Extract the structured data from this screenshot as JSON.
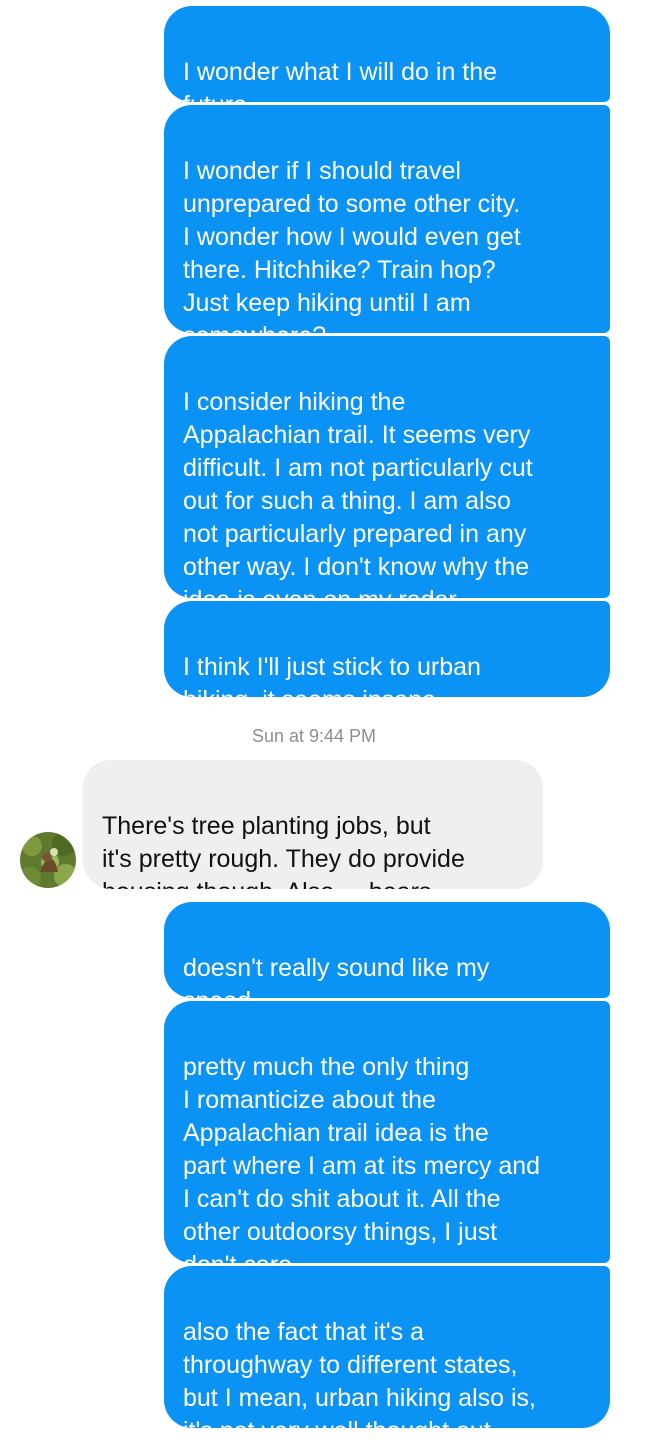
{
  "thread": {
    "messages_before": [
      {
        "sender": "me",
        "text": "I wonder what I will do in the\nfuture."
      },
      {
        "sender": "me",
        "text": "I wonder if I should travel\nunprepared to some other city.\nI wonder how I would even get\nthere. Hitchhike? Train hop?\nJust keep hiking until I am\nsomewhere?"
      },
      {
        "sender": "me",
        "text": "I consider hiking the\nAppalachian trail. It seems very\ndifficult. I am not particularly cut\nout for such a thing. I am also\nnot particularly prepared in any\nother way. I don't know why the\nidea is even on my radar."
      },
      {
        "sender": "me",
        "text": "I think I'll just stick to urban\nhiking, it seems insane"
      }
    ],
    "timestamp": "Sun at 9:44 PM",
    "incoming": {
      "sender": "other",
      "text": "There's tree planting jobs, but\nit's pretty rough. They do provide\nhousing though. Also ... bears."
    },
    "messages_after": [
      {
        "sender": "me",
        "text": "doesn't really sound like my\nspeed"
      },
      {
        "sender": "me",
        "text": "pretty much the only thing\nI romanticize about the\nAppalachian trail idea is the\npart where I am at its mercy and\nI can't do shit about it. All the\nother outdoorsy things, I just\ndon't care"
      },
      {
        "sender": "me",
        "text": "also the fact that it's a\nthroughway to different states,\nbut I mean, urban hiking also is,\nit's not very well thought out"
      }
    ]
  },
  "colors": {
    "outgoing_bubble": "#0a93f5",
    "incoming_bubble": "#efefef",
    "timestamp_text": "#8e8e8e"
  },
  "icons": {
    "avatar": "contact-avatar-photo"
  }
}
